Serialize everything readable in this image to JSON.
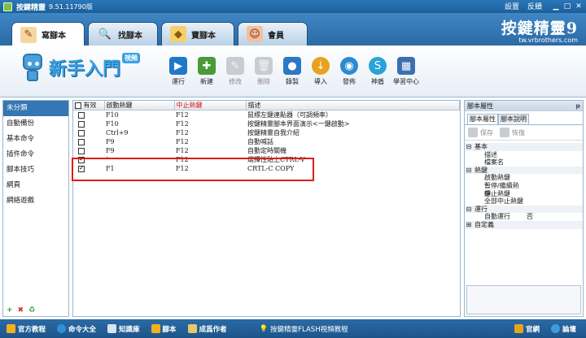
{
  "titlebar": {
    "title": "按鍵精靈",
    "version": "9.51.11790版",
    "settings_label": "設置",
    "feedback_label": "反饋",
    "min_label": "▁",
    "max_label": "□",
    "close_label": "✕"
  },
  "tabs": [
    {
      "label": "寫腳本",
      "icon": "pen-notebook-icon",
      "active": true
    },
    {
      "label": "找腳本",
      "icon": "magnifier-icon",
      "active": false
    },
    {
      "label": "寶腳本",
      "icon": "treasure-icon",
      "active": false
    },
    {
      "label": "會員",
      "icon": "member-icon",
      "active": false
    }
  ],
  "brand": {
    "name": "按鍵精靈9",
    "url": "tw.vrbrothers.com"
  },
  "logo": {
    "text": "新手入門",
    "badge": "視頻"
  },
  "toolbar": [
    {
      "label": "運行",
      "icon": "run-icon",
      "enabled": true,
      "color": "#1f78c8"
    },
    {
      "label": "新建",
      "icon": "new-script-icon",
      "enabled": true,
      "color": "#4a9a3a"
    },
    {
      "label": "修改",
      "icon": "edit-icon",
      "enabled": false,
      "color": "#c9ccd0"
    },
    {
      "label": "刪除",
      "icon": "trash-icon",
      "enabled": false,
      "color": "#c9ccd0"
    },
    {
      "label": "錄製",
      "icon": "record-icon",
      "enabled": true,
      "color": "#2b78c4"
    },
    {
      "label": "導入",
      "icon": "import-icon",
      "enabled": true,
      "color": "#e7a21e"
    },
    {
      "label": "發佈",
      "icon": "publish-icon",
      "enabled": true,
      "color": "#2c8ad0"
    },
    {
      "label": "神盾",
      "icon": "shield-icon",
      "enabled": true,
      "color": "#2aa3d9"
    },
    {
      "label": "學習中心",
      "icon": "learning-center-icon",
      "enabled": true,
      "color": "#3c6fb0"
    }
  ],
  "categories": [
    {
      "label": "未分類",
      "selected": true
    },
    {
      "label": "自動備份",
      "selected": false
    },
    {
      "label": "基本命令",
      "selected": false
    },
    {
      "label": "插件命令",
      "selected": false
    },
    {
      "label": "腳本技巧",
      "selected": false
    },
    {
      "label": "網頁",
      "selected": false
    },
    {
      "label": "網絡遊戲",
      "selected": false
    }
  ],
  "left_actions": {
    "add": "+",
    "delete": "✖",
    "refresh": "♻"
  },
  "grid": {
    "columns": [
      "有效",
      "啟動熱鍵",
      "中止熱鍵",
      "描述"
    ],
    "rows": [
      {
        "checked": false,
        "start": "F10",
        "stop": "F12",
        "desc": "鼠標左鍵連點器（可調頻率）"
      },
      {
        "checked": false,
        "start": "F10",
        "stop": "F12",
        "desc": "按鍵精靈腳本界面演示<一鍵啟動>"
      },
      {
        "checked": false,
        "start": "Ctrl+9",
        "stop": "F12",
        "desc": "按鍵精靈自我介紹"
      },
      {
        "checked": false,
        "start": "F9",
        "stop": "F12",
        "desc": "自動喊話"
      },
      {
        "checked": false,
        "start": "F9",
        "stop": "F12",
        "desc": "自動定時關機"
      },
      {
        "checked": true,
        "start": "`",
        "stop": "F12",
        "desc": "選擇性貼上CTRL-V"
      },
      {
        "checked": true,
        "start": "F1",
        "stop": "F12",
        "desc": "CRTL-C COPY"
      }
    ]
  },
  "properties": {
    "title": "腳本屬性",
    "pin": "ᵽ",
    "tabs": [
      "腳本屬性",
      "腳本說明"
    ],
    "save_label": "保存",
    "restore_label": "恢復",
    "items": [
      {
        "type": "group",
        "toggle": "⊟",
        "name": "基本",
        "value": ""
      },
      {
        "type": "item",
        "name": "描述",
        "value": ""
      },
      {
        "type": "item",
        "name": "檔案名",
        "value": ""
      },
      {
        "type": "group",
        "toggle": "⊟",
        "name": "熱鍵",
        "value": ""
      },
      {
        "type": "item",
        "name": "啟動熱鍵",
        "value": ""
      },
      {
        "type": "item",
        "name": "暫停/繼續熱鍵",
        "value": ""
      },
      {
        "type": "item",
        "name": "中止熱鍵",
        "value": ""
      },
      {
        "type": "item",
        "name": "全部中止熱鍵",
        "value": ""
      },
      {
        "type": "group",
        "toggle": "⊟",
        "name": "運行",
        "value": ""
      },
      {
        "type": "item",
        "name": "自動運行",
        "value": "否"
      },
      {
        "type": "group",
        "toggle": "⊞",
        "name": "自定義",
        "value": ""
      }
    ]
  },
  "bottombar": {
    "links": [
      {
        "label": "官方教程",
        "icon": "tutorial-icon",
        "color": "#f2b020"
      },
      {
        "label": "命令大全",
        "icon": "commands-icon",
        "color": "#2e8fd8"
      },
      {
        "label": "知識庫",
        "icon": "knowledge-icon",
        "color": "#d8e4ef"
      },
      {
        "label": "腳本",
        "icon": "script-icon",
        "color": "#f2b020"
      },
      {
        "label": "成爲作者",
        "icon": "author-icon",
        "color": "#e6c96a"
      }
    ],
    "tip": "按鍵精靈FLASH視頻教程",
    "right_links": [
      {
        "label": "官網",
        "icon": "home-icon",
        "color": "#e7a21e"
      },
      {
        "label": "論壇",
        "icon": "forum-icon",
        "color": "#3f9ae0"
      }
    ]
  }
}
